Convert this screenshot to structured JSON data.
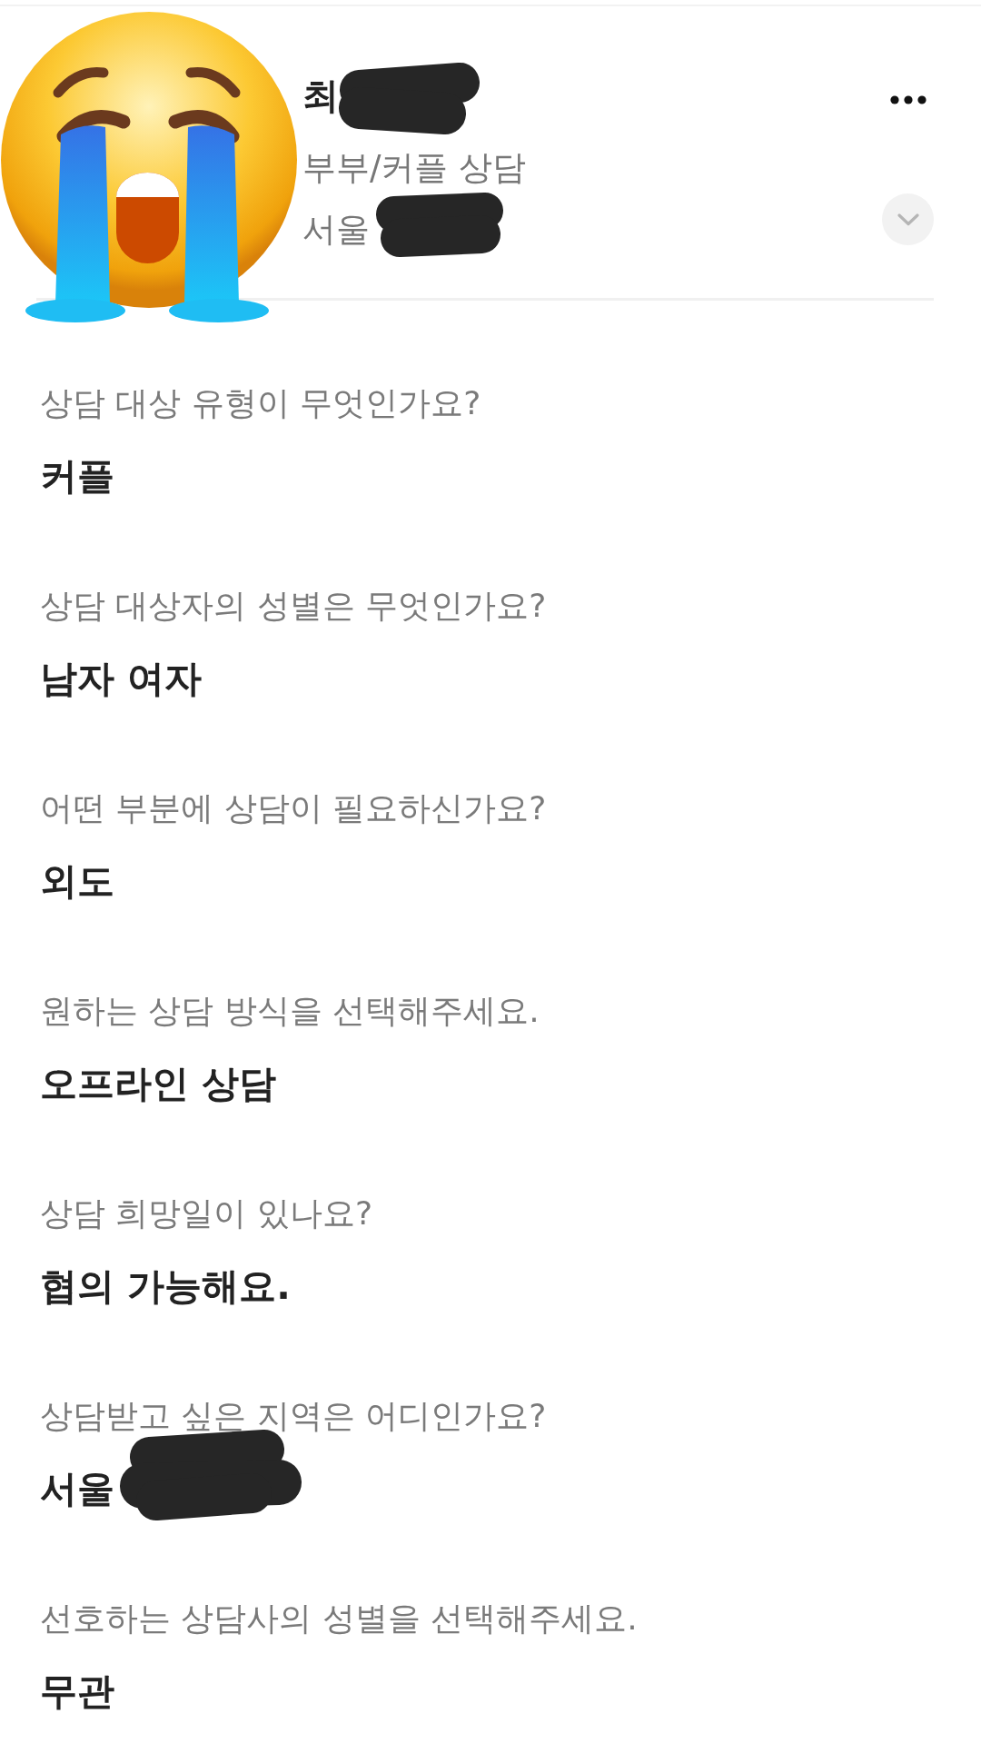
{
  "header": {
    "name": {
      "text": "최",
      "redacted": true
    },
    "category": "부부/커플 상담",
    "location": {
      "text": "서울",
      "redacted": true
    }
  },
  "questions": [
    {
      "question": "상담 대상 유형이 무엇인가요?",
      "answer": "커플",
      "redacted": false
    },
    {
      "question": "상담 대상자의 성별은 무엇인가요?",
      "answer": "남자 여자",
      "redacted": false
    },
    {
      "question": "어떤 부분에 상담이 필요하신가요?",
      "answer": "외도",
      "redacted": false
    },
    {
      "question": "원하는 상담 방식을 선택해주세요.",
      "answer": "오프라인 상담",
      "redacted": false
    },
    {
      "question": "상담 희망일이 있나요?",
      "answer": "협의 가능해요.",
      "redacted": false
    },
    {
      "question": "상담받고 싶은 지역은 어디인가요?",
      "answer": "서울",
      "redacted": true
    },
    {
      "question": "선호하는 상담사의 성별을 선택해주세요.",
      "answer": "무관",
      "redacted": false
    }
  ]
}
